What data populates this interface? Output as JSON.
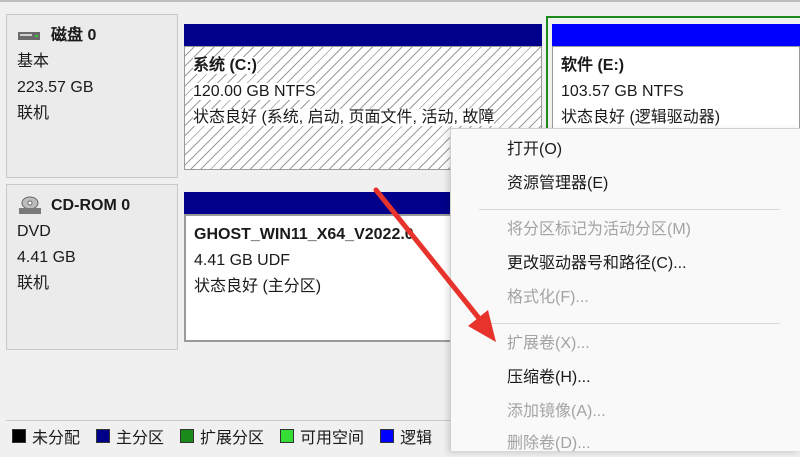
{
  "disks": [
    {
      "name": "磁盘 0",
      "type": "基本",
      "size": "223.57 GB",
      "status": "联机"
    },
    {
      "name": "CD-ROM 0",
      "type": "DVD",
      "size": "4.41 GB",
      "status": "联机"
    }
  ],
  "partitions": {
    "c": {
      "title": "系统  (C:)",
      "size": "120.00 GB NTFS",
      "status": "状态良好 (系统, 启动, 页面文件, 活动, 故障"
    },
    "e": {
      "title": "软件  (E:)",
      "size": "103.57 GB NTFS",
      "status": "状态良好 (逻辑驱动器)"
    },
    "cd": {
      "title": "GHOST_WIN11_X64_V2022.0",
      "size": "4.41 GB UDF",
      "status": "状态良好 (主分区)"
    }
  },
  "legend": [
    {
      "label": "未分配",
      "color": "#000000"
    },
    {
      "label": "主分区",
      "color": "#00008b"
    },
    {
      "label": "扩展分区",
      "color": "#1a8a1a"
    },
    {
      "label": "可用空间",
      "color": "#33dd33"
    },
    {
      "label": "逻辑",
      "color": "#0000ff"
    }
  ],
  "context_menu": [
    {
      "label": "打开(O)",
      "enabled": true
    },
    {
      "label": "资源管理器(E)",
      "enabled": true
    },
    {
      "label": "将分区标记为活动分区(M)",
      "enabled": false
    },
    {
      "label": "更改驱动器号和路径(C)...",
      "enabled": true
    },
    {
      "label": "格式化(F)...",
      "enabled": false
    },
    {
      "label": "扩展卷(X)...",
      "enabled": false
    },
    {
      "label": "压缩卷(H)...",
      "enabled": true
    },
    {
      "label": "添加镜像(A)...",
      "enabled": false
    },
    {
      "label": "删除卷(D)...",
      "enabled": false
    }
  ],
  "colors": {
    "primary_partition": "#00008b",
    "extended_partition": "#1a8a1a",
    "logical_drive": "#0000ff",
    "annotation_arrow": "#e8322c"
  }
}
